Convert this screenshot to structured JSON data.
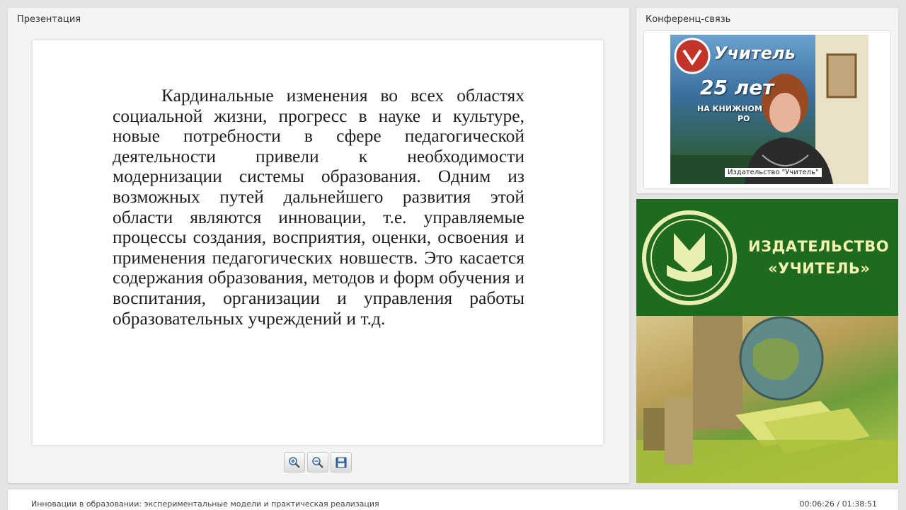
{
  "presentation": {
    "title": "Презентация",
    "slide_text": "Кардинальные изменения во всех областях социальной жизни, прогресс в науке и культуре, новые потребности в сфере педагогической деятельности привели к необходимости модернизации системы образования. Одним из возможных путей дальнейшего развития этой области являются инновации, т.е. управляемые процессы создания, восприятия, оценки, освоения и применения педагогических новшеств. Это касается содержания образования, методов и форм обучения и воспитания, организации и управления работы образовательных учреждений и т.д.",
    "toolbar": {
      "zoom_in_icon": "zoom-in-icon",
      "zoom_out_icon": "zoom-out-icon",
      "save_icon": "save-icon"
    }
  },
  "conference": {
    "title": "Конференц-связь",
    "video_caption": "Издательство \"Учитель\"",
    "banner": {
      "brand": "Учитель",
      "years": "25 лет",
      "line": "НА КНИЖНОМ",
      "line2": "РО"
    }
  },
  "ad": {
    "title_line1": "ИЗДАТЕЛЬСТВО",
    "title_line2": "«УЧИТЕЛЬ»"
  },
  "footer": {
    "course_title": "Инновации в образовании: экспериментальные модели и практическая реализация",
    "time": "00:06:26 / 01:38:51"
  },
  "colors": {
    "background": "#e4e4e4",
    "ad_green": "#1e6a1e",
    "ad_text": "#f2f2b0"
  }
}
